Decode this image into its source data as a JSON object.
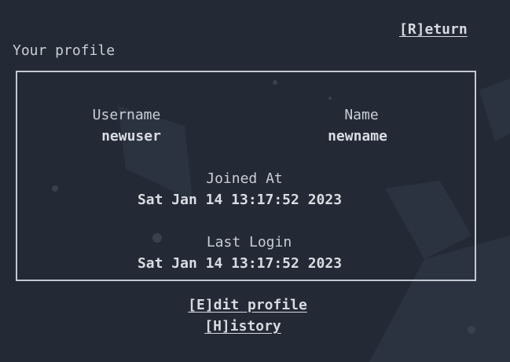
{
  "header": {
    "return_label": "[R]eturn",
    "title": "Your profile"
  },
  "profile": {
    "username_label": "Username",
    "username_value": "newuser",
    "name_label": "Name",
    "name_value": "newname",
    "joined_label": "Joined At",
    "joined_value": "Sat Jan 14 13:17:52 2023",
    "last_login_label": "Last Login",
    "last_login_value": "Sat Jan 14 13:17:52 2023"
  },
  "actions": {
    "edit_label": "[E]dit profile",
    "history_label": "[H]istory"
  },
  "colors": {
    "background": "#232a35",
    "text": "#c9ced6",
    "border": "#c4c9d1"
  }
}
